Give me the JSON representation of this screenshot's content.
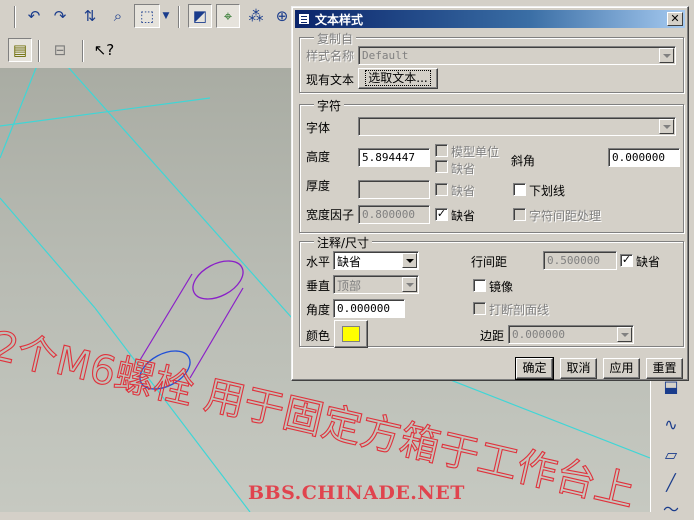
{
  "dialog": {
    "title": "文本样式",
    "close_symbol": "✕",
    "copy_group": {
      "legend": "复制自",
      "style_name_label": "样式名称",
      "style_name_value": "Default",
      "existing_text_label": "现有文本",
      "select_text_button": "选取文本..."
    },
    "char_group": {
      "legend": "字符",
      "font_label": "字体",
      "font_value": "",
      "height_label": "高度",
      "height_value": "5.894447",
      "model_units_label": "模型单位",
      "default_label_1": "缺省",
      "slant_label": "斜角",
      "slant_value": "0.000000",
      "thickness_label": "厚度",
      "thickness_value": "",
      "default_label_2": "缺省",
      "underline_label": "下划线",
      "width_factor_label": "宽度因子",
      "width_factor_value": "0.800000",
      "default_label_3": "缺省",
      "char_spacing_label": "字符间距处理",
      "default_3_checked": "✓"
    },
    "note_group": {
      "legend": "注释/尺寸",
      "horizontal_label": "水平",
      "horizontal_value": "缺省",
      "line_spacing_label": "行间距",
      "line_spacing_value": "0.500000",
      "default_label": "缺省",
      "default_checked": "✓",
      "vertical_label": "垂直",
      "vertical_value": "顶部",
      "mirror_label": "镜像",
      "angle_label": "角度",
      "angle_value": "0.000000",
      "break_hatch_label": "打断剖面线",
      "color_label": "颜色",
      "color_value": "#ffff00",
      "margin_label": "边距",
      "margin_value": "0.000000"
    },
    "buttons": {
      "ok": "确定",
      "cancel": "取消",
      "apply": "应用",
      "reset": "重置"
    }
  },
  "viewport": {
    "annotation_text": "2个M6螺栓  用于固定方箱于工作台上",
    "annotation_color": "#e0323c",
    "watermark": "BBS.CHINADE.NET"
  },
  "icons": {
    "toolbar_row1": [
      "undo-icon",
      "redo-icon",
      "regenerate-icon",
      "find-icon",
      "select-box-icon",
      "dropdown-icon",
      "datum-display-icon",
      "axis-display-icon",
      "point-display-icon",
      "zoom-icon"
    ],
    "toolbar_row2": [
      "layer-icon",
      "model-tree-icon",
      "whats-this-icon"
    ]
  }
}
